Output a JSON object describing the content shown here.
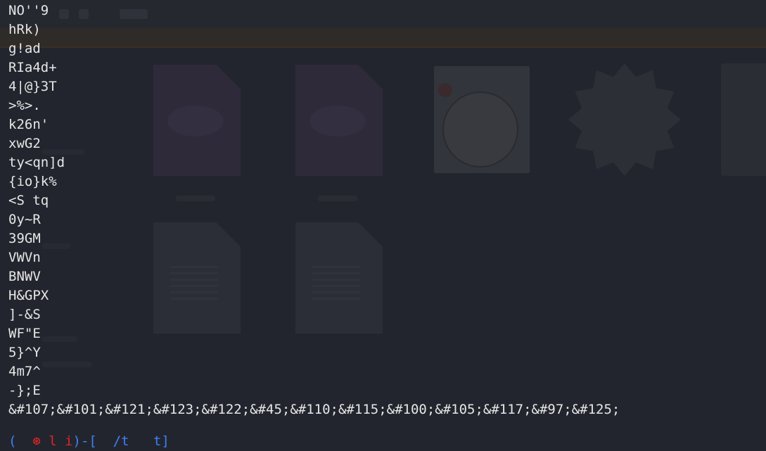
{
  "terminal": {
    "output_lines": [
      "NO''9",
      "hRk)",
      "g!ad",
      "RIa4d+",
      "4|@}3T",
      ">%>.",
      "k26n'",
      "xwG2",
      "ty<qn]d",
      "{io}k%",
      "<S tq",
      "0y~R",
      "39GM",
      "VWVn",
      "BNWV",
      "H&GPX",
      "]-&S",
      "WF\"E",
      "5}^Y",
      "4m7^",
      "-};E",
      "&#107;&#101;&#121;&#123;&#122;&#45;&#110;&#115;&#100;&#105;&#117;&#97;&#125;"
    ],
    "prompt": {
      "open_paren": "(",
      "user_host": "  ⊛ l i",
      "close_paren": ")",
      "dir": "-[  /t   t]"
    }
  },
  "colors": {
    "background": "#23252e",
    "text": "#e6e6e6",
    "prompt_blue": "#3b82f6",
    "prompt_red": "#dc2626"
  },
  "background_icons": [
    "php-file-icon",
    "php-file-icon",
    "image-thumbnail",
    "gear-icon",
    "text-file-icon",
    "text-file-icon"
  ]
}
